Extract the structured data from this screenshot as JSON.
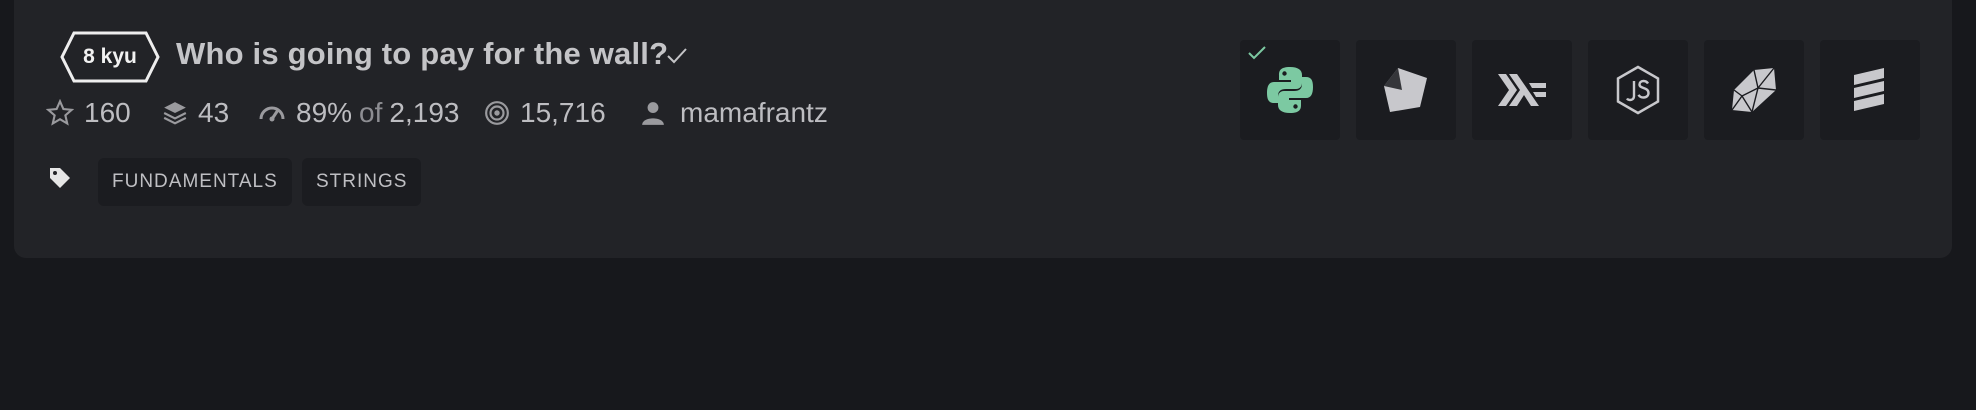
{
  "kata": {
    "rank": "8 kyu",
    "title": "Who is going to pay for the wall?",
    "completed": true
  },
  "stats": {
    "stars": "160",
    "collections": "43",
    "satisfaction_percent": "89%",
    "satisfaction_of": "of",
    "satisfaction_votes": "2,193",
    "completions": "15,716",
    "author": "mamafrantz"
  },
  "tags": [
    "FUNDAMENTALS",
    "STRINGS"
  ],
  "languages": [
    {
      "name": "python-icon",
      "active": true,
      "trained": true
    },
    {
      "name": "crystal-icon",
      "active": false
    },
    {
      "name": "haskell-icon",
      "active": false
    },
    {
      "name": "javascript-icon",
      "active": false
    },
    {
      "name": "ruby-icon",
      "active": false
    },
    {
      "name": "elixir-icon",
      "active": false
    }
  ],
  "colors": {
    "background": "#17181c",
    "card": "#222327",
    "tile": "#1b1c20",
    "text": "#c4c4c7",
    "accent_green": "#7cc9a2"
  }
}
